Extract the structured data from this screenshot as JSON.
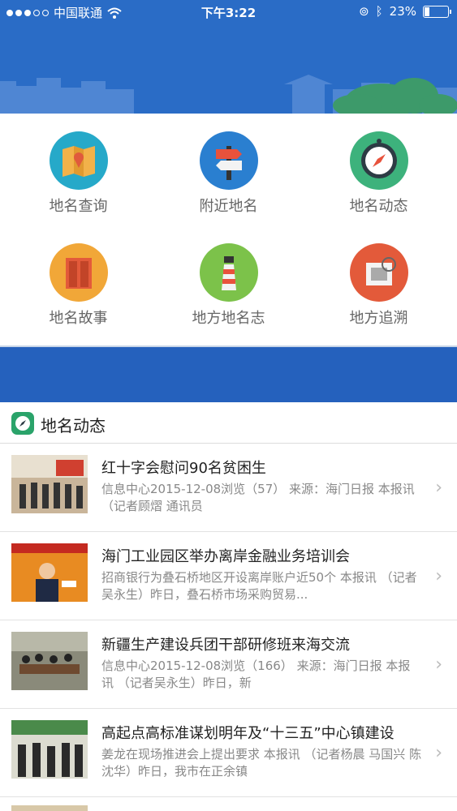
{
  "status": {
    "carrier": "中国联通",
    "time": "下午3:22",
    "battery": "23%"
  },
  "menu": [
    {
      "label": "地名查询",
      "icon": "map-icon"
    },
    {
      "label": "附近地名",
      "icon": "signpost-icon"
    },
    {
      "label": "地名动态",
      "icon": "compass-icon"
    },
    {
      "label": "地名故事",
      "icon": "book-icon"
    },
    {
      "label": "地方地名志",
      "icon": "lighthouse-icon"
    },
    {
      "label": "地方追溯",
      "icon": "stamp-icon"
    }
  ],
  "section": {
    "title": "地名动态",
    "icon": "compass-icon"
  },
  "news": [
    {
      "title": "红十字会慰问90名贫困生",
      "summary": "信息中心2015-12-08浏览（57）    来源：海门日报 本报讯    （记者顾熠   通讯员"
    },
    {
      "title": "海门工业园区举办离岸金融业务培训会",
      "summary": "招商银行为叠石桥地区开设离岸账户近50个       本报讯    （记者吴永生）昨日，叠石桥市场采购贸易..."
    },
    {
      "title": "新疆生产建设兵团干部研修班来海交流",
      "summary": "信息中心2015-12-08浏览（166）    来源：海门日报 本报讯    （记者吴永生）昨日，新"
    },
    {
      "title": "高起点高标准谋划明年及“十三五”中心镇建设",
      "summary": "姜龙在现场推进会上提出要求    本报讯    （记者杨晨    马国兴    陈沈华）昨日，我市在正余镇"
    }
  ]
}
